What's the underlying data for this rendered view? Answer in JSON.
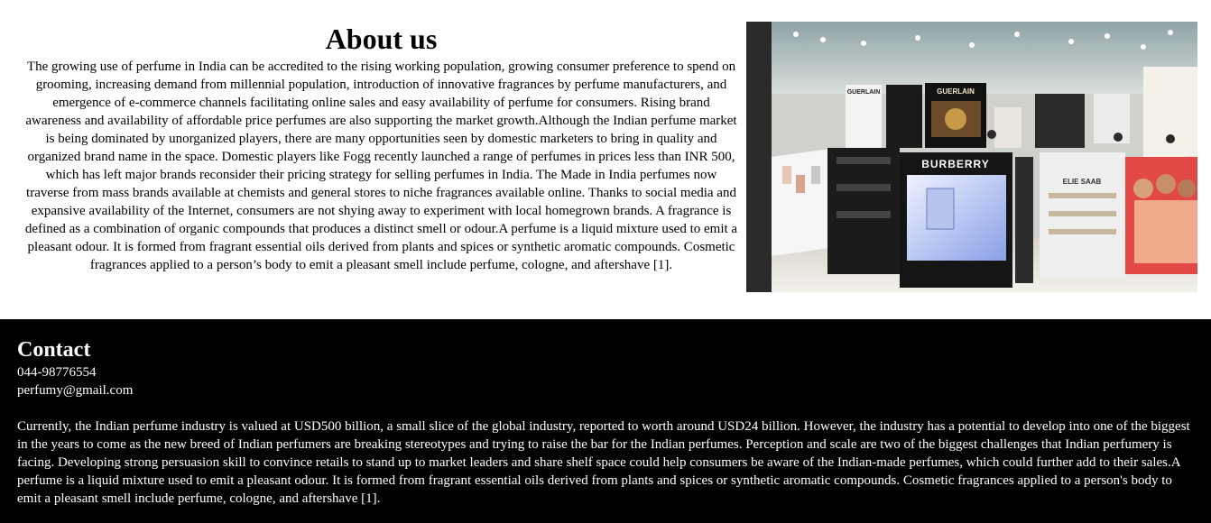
{
  "about": {
    "title": "About us",
    "body": "The growing use of perfume in India can be accredited to the rising working population, growing consumer preference to spend on grooming, increasing demand from millennial population, introduction of innovative fragrances by perfume manufacturers, and emergence of e-commerce channels facilitating online sales and easy availability of perfume for consumers. Rising brand awareness and availability of affordable price perfumes are also supporting the market growth.Although the Indian perfume market is being dominated by unorganized players, there are many opportunities seen by domestic marketers to bring in quality and organized brand name in the space. Domestic players like Fogg recently launched a range of perfumes in prices less than INR 500, which has left major brands reconsider their pricing strategy for selling perfumes in India. The Made in India perfumes now traverse from mass brands available at chemists and general stores to niche fragrances available online. Thanks to social media and expansive availability of the Internet, consumers are not shying away to experiment with local homegrown brands. A fragrance is defined as a combination of organic compounds that produces a distinct smell or odour.A perfume is a liquid mixture used to emit a pleasant odour. It is formed from fragrant essential oils derived from plants and spices or synthetic aromatic compounds. Cosmetic fragrances applied to a person’s body to emit a pleasant smell include perfume, cologne, and aftershave [1].",
    "photo_signs": [
      "GUERLAIN",
      "GUERLAIN",
      "BURBERRY",
      "ELIE SAAB"
    ]
  },
  "contact": {
    "title": "Contact",
    "phone": "044-98776554",
    "email": "perfumy@gmail.com",
    "body": "Currently, the Indian perfume industry is valued at USD500 billion, a small slice of the global industry, reported to worth around USD24 billion. However, the industry has a potential to develop into one of the biggest in the years to come as the new breed of Indian perfumers are breaking stereotypes and trying to raise the bar for the Indian perfumes. Perception and scale are two of the biggest challenges that Indian perfumery is facing. Developing strong persuasion skill to convince retails to stand up to market leaders and share shelf space could help consumers be aware of the Indian-made perfumes, which could further add to their sales.A perfume is a liquid mixture used to emit a pleasant odour. It is formed from fragrant essential oils derived from plants and spices or synthetic aromatic compounds. Cosmetic fragrances applied to a person's body to emit a pleasant smell include perfume, cologne, and aftershave [1]."
  }
}
